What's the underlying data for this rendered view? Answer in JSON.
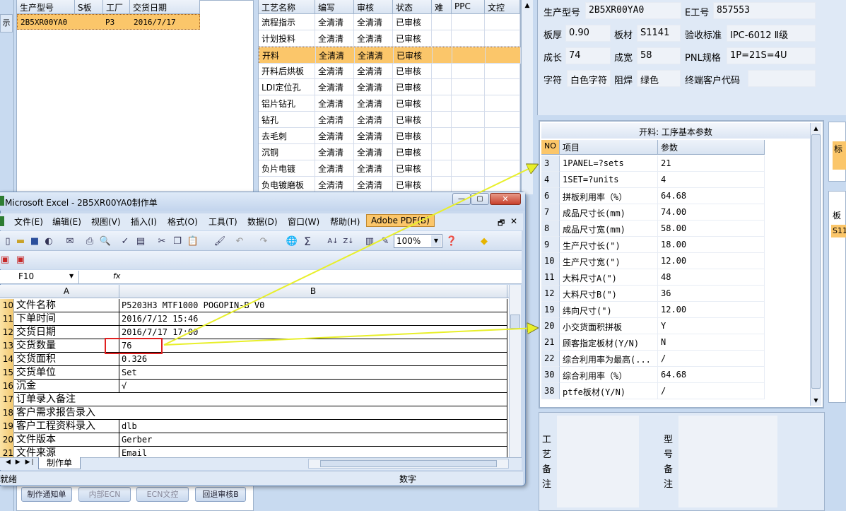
{
  "left_panel": {
    "left_stub_label": "示",
    "headers": [
      "生产型号",
      "S板",
      "工厂",
      "交货日期"
    ],
    "row": [
      "2B5XR00YA0",
      "",
      "P3",
      "2016/7/17"
    ]
  },
  "process_grid": {
    "headers": [
      "工艺名称",
      "编写",
      "审核",
      "状态",
      "难",
      "PPC",
      "文控"
    ],
    "rows": [
      [
        "流程指示",
        "全清清",
        "全清清",
        "已审核"
      ],
      [
        "计划投料",
        "全清清",
        "全清清",
        "已审核"
      ],
      [
        "开料",
        "全清清",
        "全清清",
        "已审核"
      ],
      [
        "开料后烘板",
        "全清清",
        "全清清",
        "已审核"
      ],
      [
        "LDI定位孔",
        "全清清",
        "全清清",
        "已审核"
      ],
      [
        "铝片钻孔",
        "全清清",
        "全清清",
        "已审核"
      ],
      [
        "钻孔",
        "全清清",
        "全清清",
        "已审核"
      ],
      [
        "去毛刺",
        "全清清",
        "全清清",
        "已审核"
      ],
      [
        "沉铜",
        "全清清",
        "全清清",
        "已审核"
      ],
      [
        "负片电镀",
        "全清清",
        "全清清",
        "已审核"
      ],
      [
        "负电镀磨板",
        "全清清",
        "全清清",
        "已审核"
      ]
    ]
  },
  "info": {
    "production_model_label": "生产型号",
    "production_model": "2B5XR00YA0",
    "e_no_label": "E工号",
    "e_no": "857553",
    "thickness_label": "板厚",
    "thickness": "0.90",
    "material_label": "板材",
    "material": "S1141",
    "standard_label": "验收标准",
    "standard": "IPC-6012 Ⅱ级",
    "length_label": "成长",
    "length": "74",
    "width_label": "成宽",
    "width": "58",
    "pnl_label": "PNL规格",
    "pnl": "1P=21S=4U",
    "char_label": "字符",
    "char": "白色字符",
    "mask_label": "阻焊",
    "mask": "绿色",
    "customer_code_label": "终端客户代码",
    "customer_code": ""
  },
  "params": {
    "title": "开料: 工序基本参数",
    "headers": [
      "NO",
      "项目",
      "参数"
    ],
    "rows": [
      [
        "3",
        "1PANEL=?sets",
        "21"
      ],
      [
        "4",
        "1SET=?units",
        "4"
      ],
      [
        "6",
        "拼板利用率（%）",
        "64.68"
      ],
      [
        "7",
        "成品尺寸长(mm)",
        "74.00"
      ],
      [
        "8",
        "成品尺寸宽(mm)",
        "58.00"
      ],
      [
        "9",
        "生产尺寸长(\")",
        "18.00"
      ],
      [
        "10",
        "生产尺寸宽(\")",
        "12.00"
      ],
      [
        "11",
        "大料尺寸A(\")",
        "48"
      ],
      [
        "12",
        "大料尺寸B(\")",
        "36"
      ],
      [
        "19",
        "纬向尺寸(\")",
        "12.00"
      ],
      [
        "20",
        "小交货面积拼板",
        "Y"
      ],
      [
        "21",
        "顾客指定板材(Y/N)",
        "N"
      ],
      [
        "22",
        "综合利用率为最高(...",
        "/"
      ],
      [
        "30",
        "综合利用率（%）",
        "64.68"
      ],
      [
        "38",
        "ptfe板材(Y/N)",
        "/"
      ]
    ]
  },
  "right_stub": {
    "top_label": "标",
    "mid_label": "板",
    "mid_value": "S11"
  },
  "notes": {
    "process_note_label": "工艺备注",
    "model_note_label": "型号备注"
  },
  "excel": {
    "title": "Microsoft Excel - 2B5XR00YA0制作单",
    "menu": [
      "文件(E)",
      "编辑(E)",
      "视图(V)",
      "插入(I)",
      "格式(O)",
      "工具(T)",
      "数据(D)",
      "窗口(W)",
      "帮助(H)",
      "Adobe PDF(B)"
    ],
    "zoom": "100%",
    "name_box": "F10",
    "fx": "fx",
    "col_a": "A",
    "col_b": "B",
    "rows": [
      [
        "10",
        "文件名称",
        "P5203H3 MTF1000 POGOPIN-B V0"
      ],
      [
        "11",
        "下单时间",
        "2016/7/12 15:46"
      ],
      [
        "12",
        "交货日期",
        "2016/7/17 17:00"
      ],
      [
        "13",
        "交货数量",
        "76"
      ],
      [
        "14",
        "交货面积",
        "0.326"
      ],
      [
        "15",
        "交货单位",
        "Set"
      ],
      [
        "16",
        "沉金",
        "√"
      ],
      [
        "17",
        "订单录入备注",
        ""
      ],
      [
        "18",
        "客户需求报告录入",
        ""
      ],
      [
        "19",
        "客户工程资料录入",
        "dlb"
      ],
      [
        "20",
        "文件版本",
        "Gerber"
      ],
      [
        "21",
        "文件来源",
        "Email"
      ]
    ],
    "sheet_tab": "制作单",
    "status_ready": "就绪",
    "status_num": "数字"
  },
  "bottom_buttons": [
    "制作通知单",
    "内部ECN",
    "ECN文控",
    "回退审核B"
  ],
  "colors": {
    "selection": "#fbc66a",
    "arrow": "#e8ef2a",
    "highlight_box": "#e02020"
  }
}
